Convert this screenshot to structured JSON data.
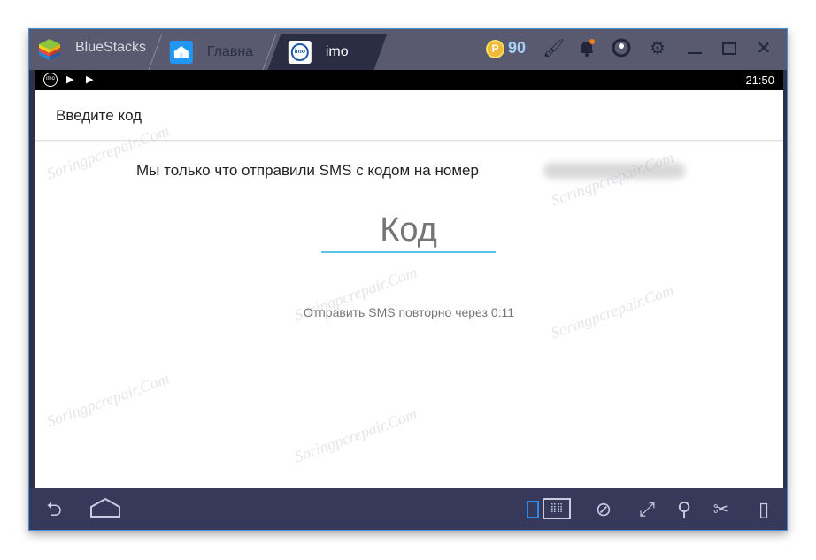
{
  "titlebar": {
    "brand": "BlueStacks",
    "tabs": [
      {
        "label": "Главна",
        "icon": "home-icon"
      },
      {
        "label": "imo",
        "icon": "imo-icon"
      }
    ],
    "coins": "90",
    "coin_symbol": "P"
  },
  "statusbar": {
    "time": "21:50",
    "icons": [
      "imo-icon",
      "play-store-icon",
      "play-store-icon"
    ]
  },
  "app": {
    "header": "Введите код",
    "message": "Мы только что отправили SMS с кодом на номер",
    "code_placeholder": "Код",
    "code_value": "",
    "resend": "Отправить SMS повторно через 0:11"
  },
  "colors": {
    "accent": "#5bc2ee",
    "titlebar": "#595a70",
    "navbar": "#36395a"
  },
  "watermark": "Soringpcrepair.Com"
}
